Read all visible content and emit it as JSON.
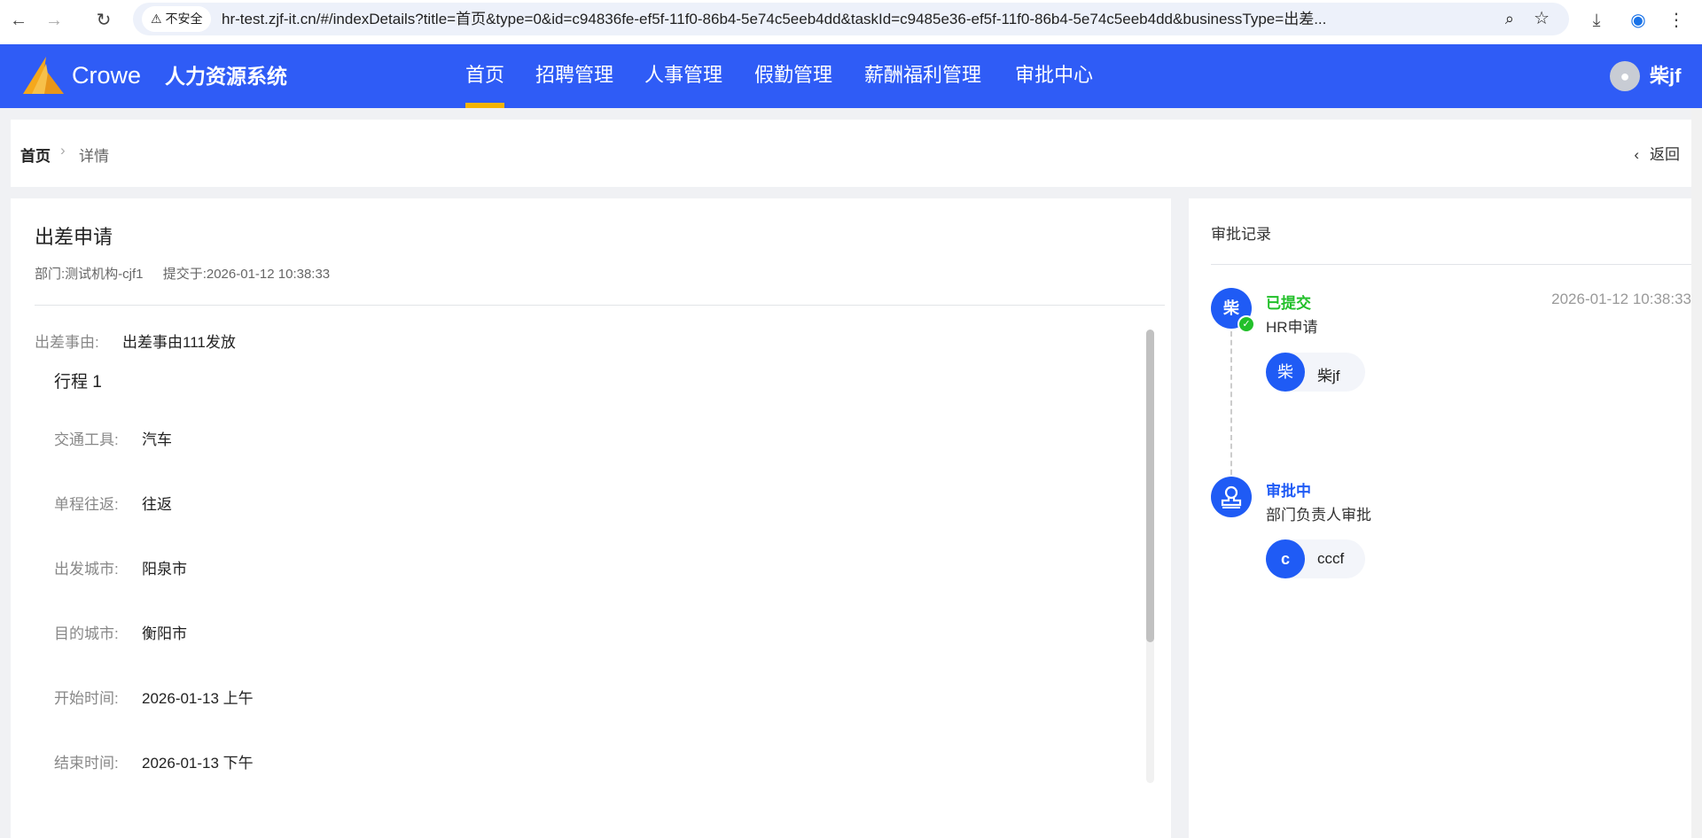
{
  "browser": {
    "security_label": "不安全",
    "url": "hr-test.zjf-it.cn/#/indexDetails?title=首页&type=0&id=c94836fe-ef5f-11f0-86b4-5e74c5eeb4dd&taskId=c9485e36-ef5f-11f0-86b4-5e74c5eeb4dd&businessType=出差..."
  },
  "header": {
    "logo_text": "Crowe",
    "system_name": "人力资源系统",
    "nav": [
      "首页",
      "招聘管理",
      "人事管理",
      "假勤管理",
      "薪酬福利管理",
      "审批中心"
    ],
    "user_name": "柴jf",
    "accent": "#2f5cf6"
  },
  "breadcrumb": {
    "home": "首页",
    "current": "详情",
    "back": "返回"
  },
  "detail": {
    "title": "出差申请",
    "department_label": "部门:",
    "department": "测试机构-cjf1",
    "submitted_label": "提交于:",
    "submitted": "2026-01-12 10:38:33",
    "reason_label": "出差事由:",
    "reason": "出差事由111发放",
    "trip_title": "行程 1",
    "fields": [
      {
        "label": "交通工具:",
        "value": "汽车"
      },
      {
        "label": "单程往返:",
        "value": "往返"
      },
      {
        "label": "出发城市:",
        "value": "阳泉市"
      },
      {
        "label": "目的城市:",
        "value": "衡阳市"
      },
      {
        "label": "开始时间:",
        "value": "2026-01-13 上午"
      },
      {
        "label": "结束时间:",
        "value": "2026-01-13 下午"
      }
    ]
  },
  "approval": {
    "title": "审批记录",
    "nodes": [
      {
        "status": "已提交",
        "status_color": "#22c02a",
        "name": "HR申请",
        "time": "2026-01-12 10:38:33",
        "avatar": "柴",
        "person_avatar": "柴",
        "person": "柴jf"
      },
      {
        "status": "审批中",
        "status_color": "#1f5bf5",
        "name": "部门负责人审批",
        "person_avatar": "c",
        "person": "cccf"
      }
    ]
  }
}
